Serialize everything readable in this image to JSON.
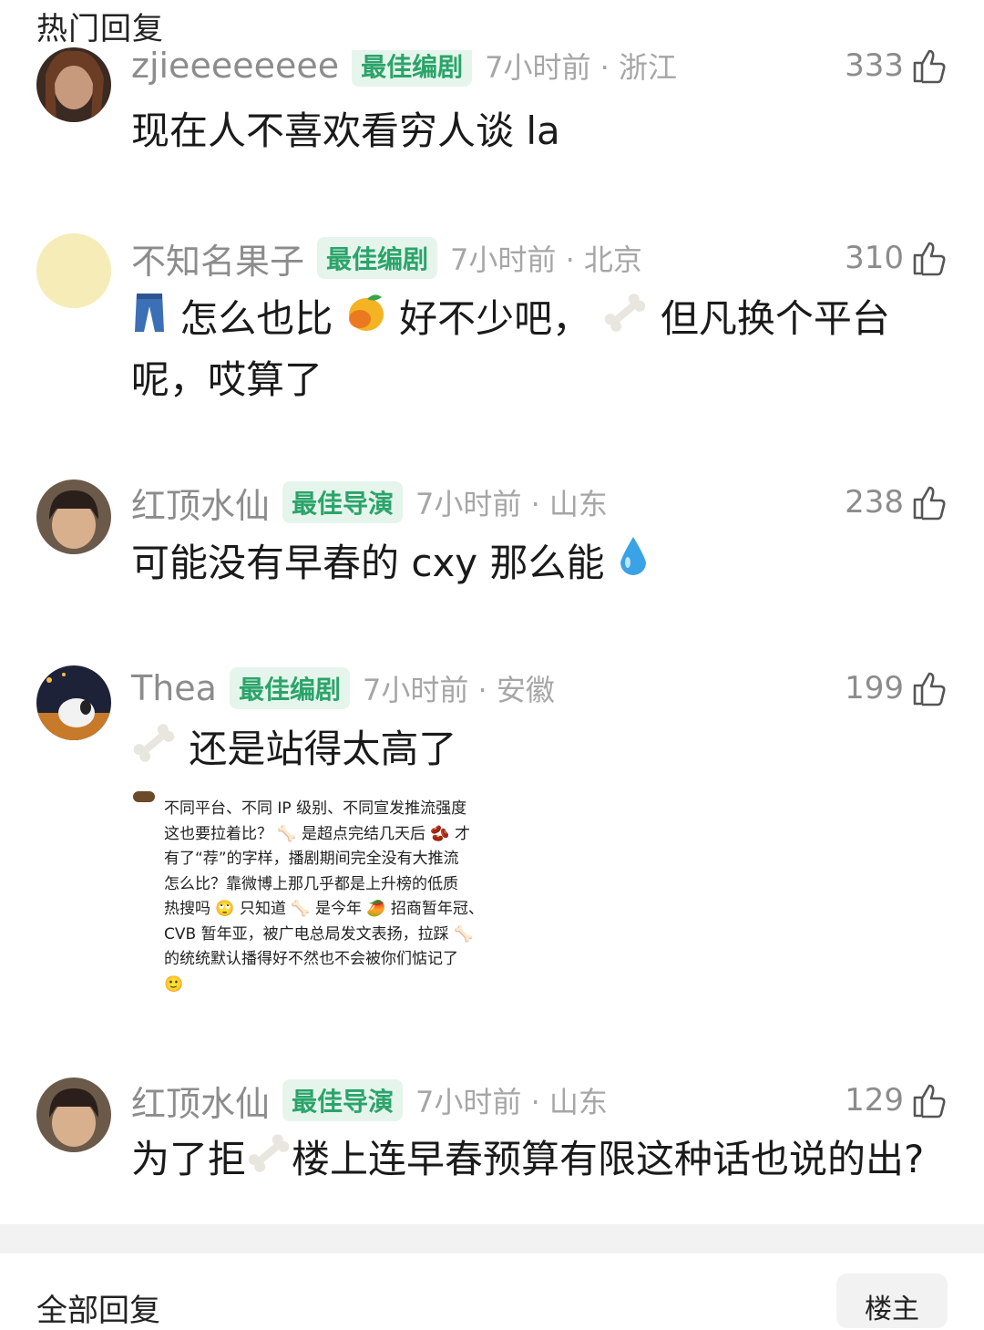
{
  "header": {
    "title": "热门回复"
  },
  "comments": [
    {
      "username": "zjieeeeeeee",
      "badge": "最佳编剧",
      "time": "7小时前 · 浙江",
      "likes": "333",
      "text": "现在人不喜欢看穷人谈 la"
    },
    {
      "username": "不知名果子",
      "badge": "最佳编剧",
      "time": "7小时前 · 北京",
      "likes": "310",
      "text_parts": [
        "怎么也比",
        "好不少吧，",
        "但凡换个平台",
        "呢，哎算了"
      ],
      "emoji": [
        "jeans-emoji",
        "mango-emoji",
        "bone-emoji"
      ]
    },
    {
      "username": "红顶水仙",
      "badge": "最佳导演",
      "time": "7小时前 · 山东",
      "likes": "238",
      "text": "可能没有早春的 cxy 那么能",
      "emoji": [
        "droplet-emoji"
      ]
    },
    {
      "username": "Thea",
      "badge": "最佳编剧",
      "time": "7小时前 · 安徽",
      "likes": "199",
      "text": "还是站得太高了",
      "emoji": [
        "bone-emoji"
      ],
      "quote_lines": [
        "不同平台、不同 IP 级别、不同宣发推流强度",
        "这也要拉着比？ 🦴 是超点完结几天后 🫘 才",
        "有了“荐”的字样，播剧期间完全没有大推流",
        "怎么比？靠微博上那几乎都是上升榜的低质",
        "热搜吗 🙄 只知道 🦴 是今年 🥭 招商暂年冠、",
        "CVB 暂年亚，被广电总局发文表扬，拉踩 🦴",
        "的统统默认播得好不然也不会被你们惦记了",
        "🙂"
      ]
    },
    {
      "username": "红顶水仙",
      "badge": "最佳导演",
      "time": "7小时前 · 山东",
      "likes": "129",
      "text_parts": [
        "为了拒",
        "楼上连早春预算有限这种话也说的出?"
      ],
      "emoji": [
        "bone-emoji"
      ]
    }
  ],
  "footer": {
    "title": "全部回复",
    "button": "楼主"
  },
  "colors": {
    "badge_text": "#2ba46a",
    "badge_bg": "#e6f5ec",
    "meta": "#a6a6a6",
    "username": "#8c8c8c"
  },
  "icons": [
    "thumbs-up-icon",
    "avatar"
  ]
}
